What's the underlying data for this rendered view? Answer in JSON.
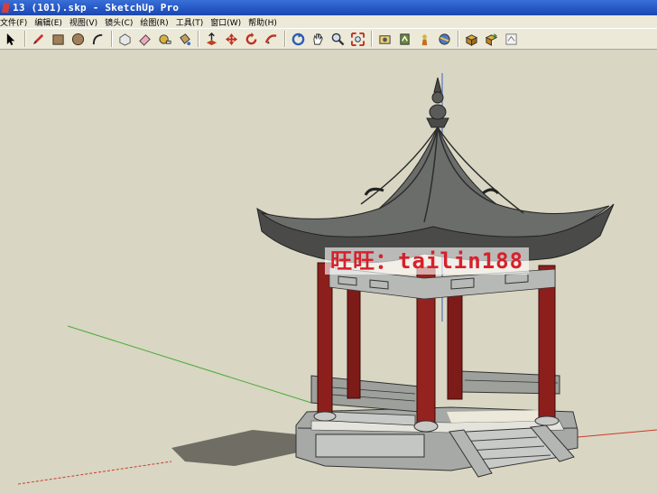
{
  "window": {
    "title": "13 (101).skp - SketchUp Pro"
  },
  "menu": [
    {
      "label": "文件(F)"
    },
    {
      "label": "编辑(E)"
    },
    {
      "label": "视图(V)"
    },
    {
      "label": "镜头(C)"
    },
    {
      "label": "绘图(R)"
    },
    {
      "label": "工具(T)"
    },
    {
      "label": "窗口(W)"
    },
    {
      "label": "帮助(H)"
    }
  ],
  "toolbar": {
    "groups": [
      [
        "select-icon"
      ],
      [
        "pencil-icon",
        "rectangle-icon",
        "circle-icon",
        "arc-icon"
      ],
      [
        "make-component-icon",
        "eraser-icon",
        "tape-measure-icon",
        "paint-bucket-icon"
      ],
      [
        "push-pull-icon",
        "move-icon",
        "rotate-icon",
        "follow-me-icon"
      ],
      [
        "orbit-icon",
        "pan-icon",
        "zoom-icon",
        "zoom-extents-icon"
      ],
      [
        "position-camera-icon",
        "walk-icon",
        "look-around-icon",
        "section-plane-icon"
      ],
      [
        "get-models-icon",
        "share-model-icon",
        "warehouse-icon"
      ]
    ]
  },
  "scene": {
    "watermark": "旺旺：tailin188",
    "colors": {
      "background": "#d9d6c3",
      "roof": "#6b6d6a",
      "roof_dark": "#3c3d3c",
      "pillar": "#8c1f1c",
      "stone": "#b7b9b6",
      "shadow": "#6f6d64"
    }
  }
}
